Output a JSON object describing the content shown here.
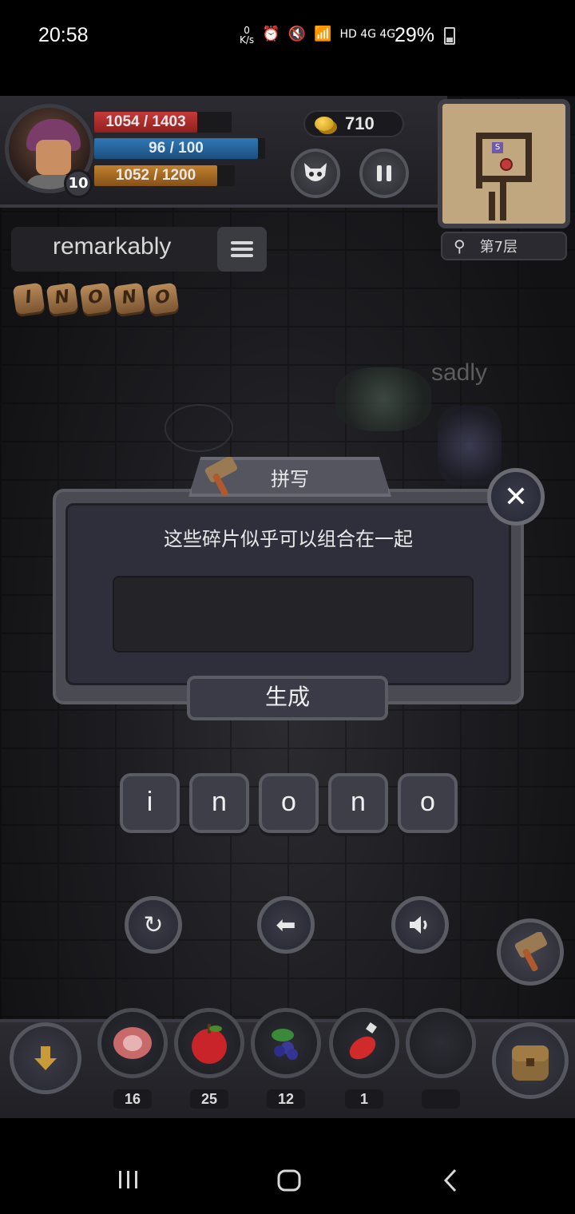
{
  "status_bar": {
    "time": "20:58",
    "net_speed": "0\nK/s",
    "network_label": "HD 4G 4G",
    "battery": "29%"
  },
  "player": {
    "level": "10",
    "hp_text": "1054 / 1403",
    "hp_fraction": 0.751,
    "mp_text": "96 / 100",
    "mp_fraction": 0.96,
    "xp_text": "1052 / 1200",
    "xp_fraction": 0.877
  },
  "hud": {
    "coins": "710",
    "floor_label": "第7层",
    "minimap_marker": "S"
  },
  "word_panel": {
    "current_word": "remarkably"
  },
  "runes": [
    "I",
    "N",
    "O",
    "N",
    "O"
  ],
  "enemy": {
    "name": "sadly"
  },
  "dialog": {
    "title": "拼写",
    "message": "这些碎片似乎可以组合在一起",
    "answer_value": "",
    "generate_label": "生成",
    "close_label": "✕"
  },
  "letters": [
    "i",
    "n",
    "o",
    "n",
    "o"
  ],
  "inventory": {
    "items": [
      {
        "name": "meat",
        "count": "16"
      },
      {
        "name": "apple",
        "count": "25"
      },
      {
        "name": "berries",
        "count": "12"
      },
      {
        "name": "potion",
        "count": "1"
      },
      {
        "name": "empty",
        "count": ""
      }
    ]
  },
  "colors": {
    "hp": "#c73a3a",
    "mp": "#2f78b5",
    "xp": "#c1802e",
    "coin": "#f0c23a"
  }
}
